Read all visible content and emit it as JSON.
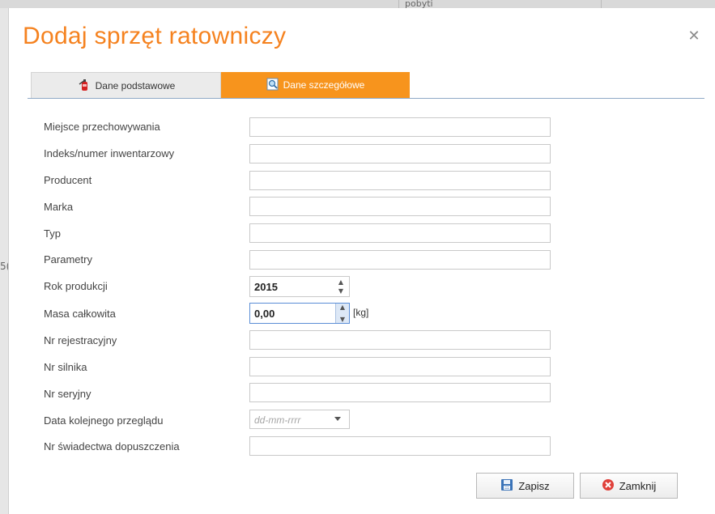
{
  "background": {
    "top_text": "pobyti",
    "left_text": "5("
  },
  "dialog": {
    "title": "Dodaj sprzęt ratowniczy",
    "close_icon": "close-icon"
  },
  "tabs": [
    {
      "label": "Dane podstawowe",
      "icon": "extinguisher-icon",
      "active": false
    },
    {
      "label": "Dane szczegółowe",
      "icon": "magnifier-doc-icon",
      "active": true
    }
  ],
  "form": {
    "fields": [
      {
        "label": "Miejsce przechowywania",
        "value": ""
      },
      {
        "label": "Indeks/numer inwentarzowy",
        "value": ""
      },
      {
        "label": "Producent",
        "value": ""
      },
      {
        "label": "Marka",
        "value": ""
      },
      {
        "label": "Typ",
        "value": ""
      },
      {
        "label": "Parametry",
        "value": ""
      }
    ],
    "rok_produkcji": {
      "label": "Rok produkcji",
      "value": "2015"
    },
    "masa": {
      "label": "Masa całkowita",
      "value": "0,00",
      "unit": "[kg]"
    },
    "fields2": [
      {
        "label": "Nr rejestracyjny",
        "value": ""
      },
      {
        "label": "Nr silnika",
        "value": ""
      },
      {
        "label": "Nr seryjny",
        "value": ""
      }
    ],
    "data_przegladu": {
      "label": "Data kolejnego przeglądu",
      "placeholder": "dd-mm-rrrr"
    },
    "nr_swiadectwa": {
      "label": "Nr świadectwa dopuszczenia",
      "value": ""
    }
  },
  "buttons": {
    "save": {
      "label": "Zapisz",
      "icon": "floppy-disk-icon"
    },
    "close": {
      "label": "Zamknij",
      "icon": "red-x-icon"
    }
  },
  "colors": {
    "accent": "#f5821f",
    "tab_active": "#f7941d"
  }
}
